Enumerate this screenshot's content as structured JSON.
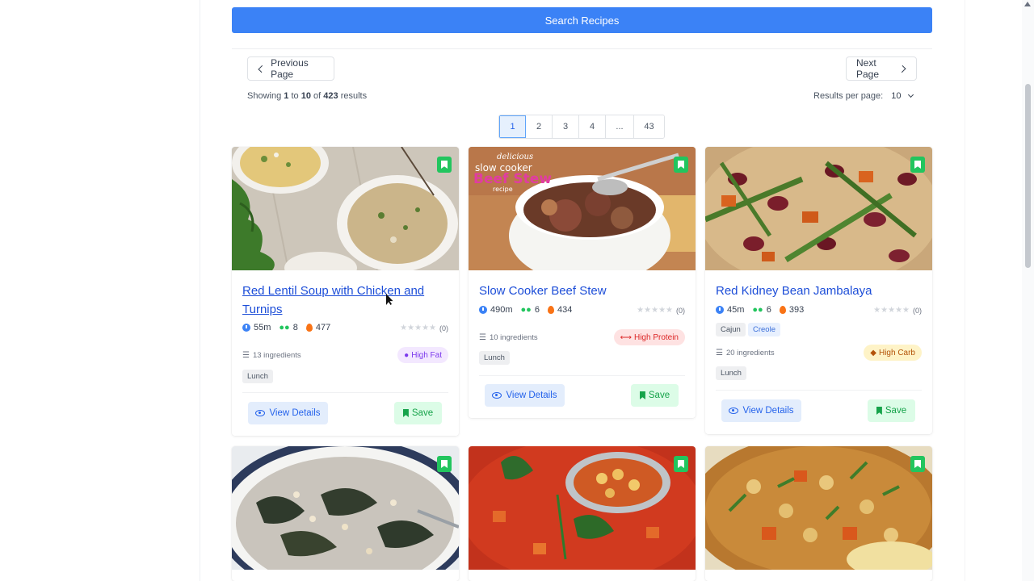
{
  "search": {
    "button_label": "Search Recipes"
  },
  "pager": {
    "prev_label": "Previous Page",
    "next_label": "Next Page",
    "showing_prefix": "Showing",
    "showing_from": "1",
    "showing_to_word": "to",
    "showing_to": "10",
    "showing_of_word": "of",
    "showing_total": "423",
    "showing_suffix": "results",
    "per_page_label": "Results per page:",
    "per_page_value": "10",
    "pages": [
      "1",
      "2",
      "3",
      "4",
      "...",
      "43"
    ],
    "current_page": "1"
  },
  "recipes": [
    {
      "title": "Red Lentil Soup with Chicken and Turnips",
      "time": "55m",
      "servings": "8",
      "calories": "477",
      "rating_count": "(0)",
      "ingredients": "13 ingredients",
      "nutrition_badge": "High Fat",
      "tags": [
        "Lunch"
      ],
      "view_label": "View Details",
      "save_label": "Save"
    },
    {
      "title": "Slow Cooker Beef Stew",
      "time": "490m",
      "servings": "6",
      "calories": "434",
      "rating_count": "(0)",
      "ingredients": "10 ingredients",
      "nutrition_badge": "High Protein",
      "tags": [
        "Lunch"
      ],
      "image_text": {
        "line1": "delicious",
        "line2": "slow cooker",
        "line3": "Beef Stew",
        "line4": "recipe"
      },
      "view_label": "View Details",
      "save_label": "Save"
    },
    {
      "title": "Red Kidney Bean Jambalaya",
      "time": "45m",
      "servings": "6",
      "calories": "393",
      "rating_count": "(0)",
      "cuisines": [
        "Cajun",
        "Creole"
      ],
      "ingredients": "20 ingredients",
      "nutrition_badge": "High Carb",
      "tags": [
        "Lunch"
      ],
      "view_label": "View Details",
      "save_label": "Save"
    }
  ],
  "colors": {
    "primary": "#3b82f6",
    "link": "#1d4ed8",
    "save_green": "#22c55e",
    "high_fat": "#7c3aed",
    "high_protein": "#dc2626",
    "high_carb": "#b45309"
  }
}
